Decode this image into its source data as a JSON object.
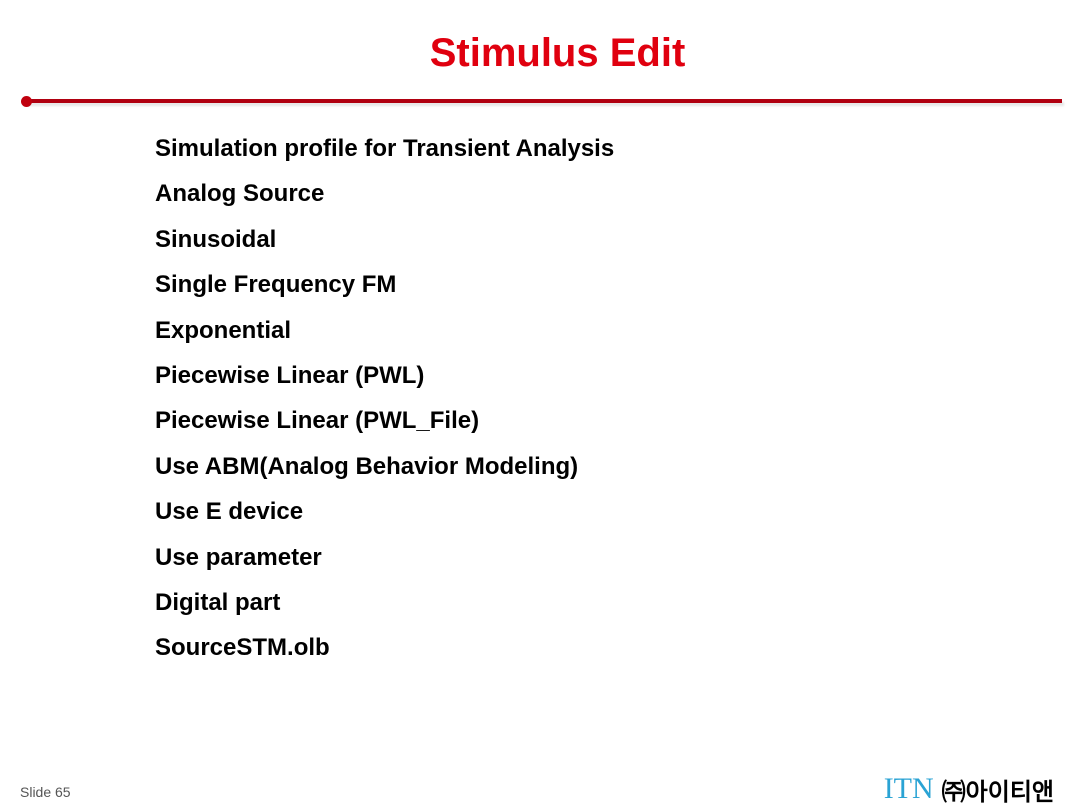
{
  "slide": {
    "title": "Stimulus Edit",
    "items": [
      "Simulation profile for Transient Analysis",
      "Analog Source",
      "Sinusoidal",
      "Single Frequency FM",
      "Exponential",
      "Piecewise Linear (PWL)",
      "Piecewise Linear (PWL_File)",
      "Use ABM(Analog Behavior Modeling)",
      "Use E device",
      "Use parameter",
      "Digital part",
      "SourceSTM.olb"
    ]
  },
  "footer": {
    "slide_number": "Slide 65",
    "logo_text": "ITN",
    "company_name": "㈜아이티앤"
  },
  "colors": {
    "title": "#e0000f",
    "rule": "#b00010",
    "logo": "#2aa3d4"
  }
}
